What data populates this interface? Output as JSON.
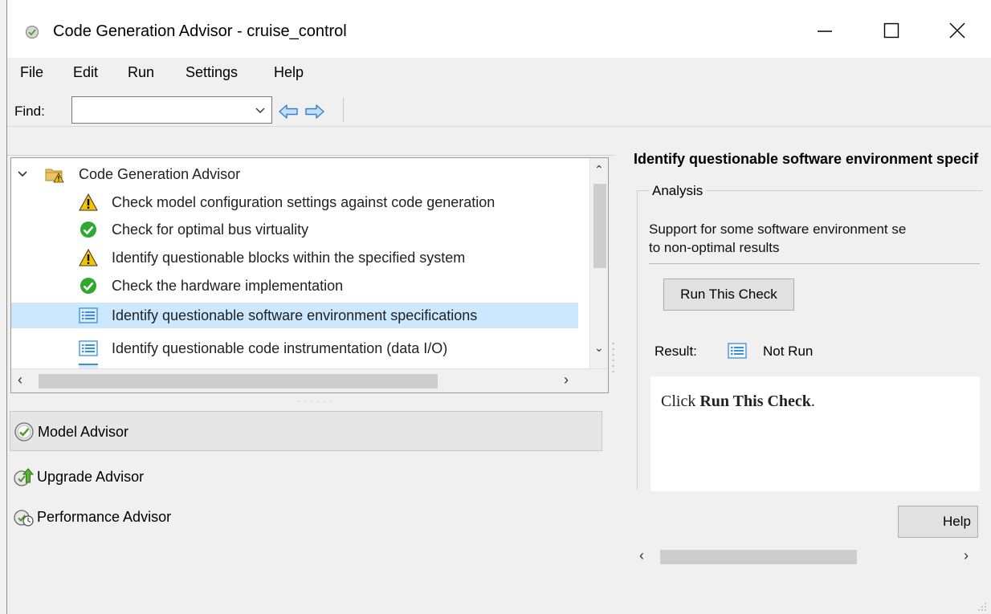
{
  "window": {
    "title": "Code Generation Advisor - cruise_control",
    "controls": {
      "minimize": "minimize",
      "maximize": "maximize",
      "close": "close"
    }
  },
  "menu": {
    "items": [
      "File",
      "Edit",
      "Run",
      "Settings",
      "Help"
    ]
  },
  "toolbar": {
    "find_label": "Find:",
    "find_value": "",
    "back_icon": "left-arrow-icon",
    "forward_icon": "right-arrow-icon"
  },
  "tree": {
    "root": {
      "label": "Code Generation Advisor",
      "icon": "folder-warning-icon",
      "expanded": true
    },
    "items": [
      {
        "label": "Check model configuration settings against code generation",
        "icon": "warning-icon",
        "status": "warning"
      },
      {
        "label": "Check for optimal bus virtuality",
        "icon": "passed-icon",
        "status": "passed"
      },
      {
        "label": "Identify questionable blocks within the specified system",
        "icon": "warning-icon",
        "status": "warning"
      },
      {
        "label": "Check the hardware implementation",
        "icon": "passed-icon",
        "status": "passed"
      },
      {
        "label": "Identify questionable software environment specifications",
        "icon": "not-run-icon",
        "status": "not-run",
        "selected": true
      },
      {
        "label": "Identify questionable code instrumentation (data I/O)",
        "icon": "not-run-icon",
        "status": "not-run"
      }
    ]
  },
  "advisors": [
    {
      "label": "Model Advisor",
      "icon": "model-advisor-icon",
      "active": true
    },
    {
      "label": "Upgrade Advisor",
      "icon": "upgrade-advisor-icon",
      "active": false
    },
    {
      "label": "Performance Advisor",
      "icon": "performance-advisor-icon",
      "active": false
    }
  ],
  "detail": {
    "title": "Identify questionable software environment specifications",
    "group_label": "Analysis",
    "analysis_line1": "Support for some software environment se",
    "analysis_line2": "to non-optimal results",
    "run_button": "Run This Check",
    "result_label": "Result:",
    "result_value": "Not Run",
    "result_msg_prefix": "Click ",
    "result_msg_bold": "Run This Check",
    "result_msg_suffix": ".",
    "help_button": "Help"
  },
  "colors": {
    "selection": "#cce8ff",
    "warning": "#f5c400",
    "passed": "#2fa82f",
    "not_run": "#3e8ed6"
  }
}
